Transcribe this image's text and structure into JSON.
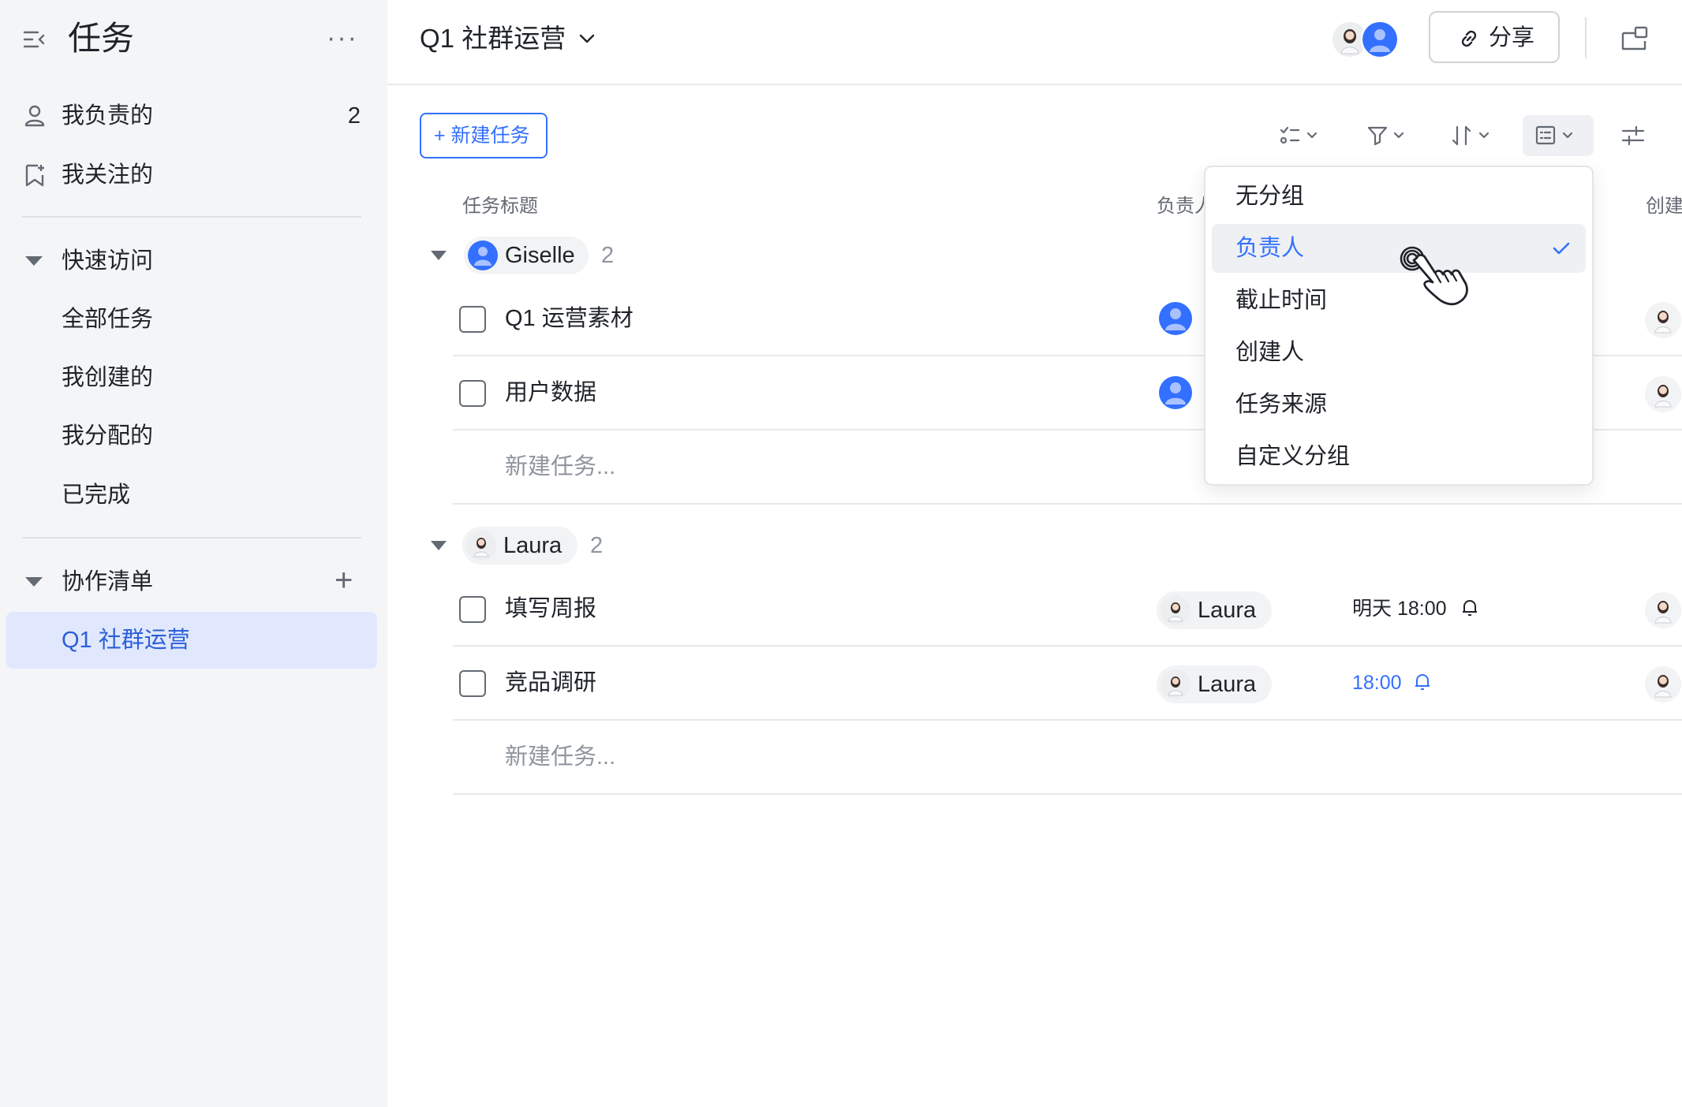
{
  "sidebar": {
    "title": "任务",
    "more": "···",
    "items": [
      {
        "label": "我负责的",
        "count": "2",
        "icon": "person-icon"
      },
      {
        "label": "我关注的",
        "icon": "bookmark-star-icon"
      }
    ],
    "quick_access": {
      "label": "快速访问",
      "items": [
        "全部任务",
        "我创建的",
        "我分配的",
        "已完成"
      ]
    },
    "collab": {
      "label": "协作清单",
      "active": "Q1 社群运营"
    }
  },
  "header": {
    "project_title": "Q1 社群运营",
    "share_label": "分享"
  },
  "toolbar": {
    "new_task_label": "+ 新建任务",
    "icons": [
      "subtask-icon",
      "filter-icon",
      "sort-icon",
      "group-view-icon",
      "settings-sliders-icon"
    ]
  },
  "table": {
    "columns": {
      "title": "任务标题",
      "assignee": "负责人",
      "creator": "创建人"
    },
    "new_task_placeholder": "新建任务...",
    "groups": [
      {
        "name": "Giselle",
        "count": "2",
        "tasks": [
          {
            "title": "Q1 运营素材",
            "assignee": "Giselle",
            "due": ""
          },
          {
            "title": "用户数据",
            "assignee": "Giselle",
            "due": ""
          }
        ]
      },
      {
        "name": "Laura",
        "count": "2",
        "tasks": [
          {
            "title": "填写周报",
            "assignee": "Laura",
            "due": "明天 18:00",
            "due_color": "#1f2329"
          },
          {
            "title": "竞品调研",
            "assignee": "Laura",
            "due": "18:00",
            "due_color": "#3370ff"
          }
        ]
      }
    ]
  },
  "group_menu": {
    "options": [
      "无分组",
      "负责人",
      "截止时间",
      "创建人",
      "任务来源",
      "自定义分组"
    ],
    "selected": "负责人"
  },
  "colors": {
    "accent": "#3370ff",
    "sidebar_bg": "#f4f5f7",
    "active_bg": "#e1e8fd",
    "active_text": "#2b5fd9"
  }
}
